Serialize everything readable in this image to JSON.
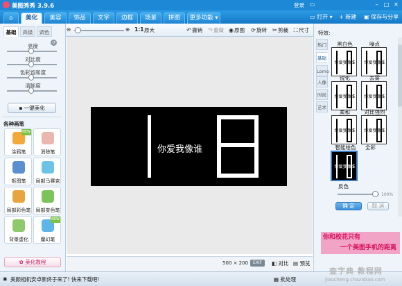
{
  "app": {
    "title": "美图秀秀 3.9.6",
    "login": "登录"
  },
  "menu": {
    "home_icon": "home-icon",
    "tabs": [
      "美化",
      "美容",
      "饰品",
      "文字",
      "边框",
      "场景",
      "拼图",
      "更多功能 ▾"
    ],
    "active_tab": "美化",
    "open": "打开 ▾",
    "new": "新建",
    "save": "保存与分享"
  },
  "toolbar": {
    "zoom_ratio": "1:1",
    "original": "原大",
    "undo": "撤销",
    "redo": "重做",
    "original_image": "原图",
    "rotate": "旋转",
    "crop": "剪裁",
    "size": "尺寸"
  },
  "left": {
    "tabs": [
      "基础",
      "高级",
      "调色"
    ],
    "active_tab": "基础",
    "sliders": [
      {
        "label": "亮度",
        "level": 0.5
      },
      {
        "label": "对比度",
        "level": 0.5
      },
      {
        "label": "色彩饱和度",
        "level": 0.5
      },
      {
        "label": "清晰度",
        "level": 0.5
      }
    ],
    "auto_button": "一键美化",
    "pen_section": "各种画笔",
    "pens": [
      "涂鸦笔",
      "消除笔",
      "抠图笔",
      "局部马赛克",
      "局部彩色笔",
      "局部变色笔",
      "背景虚化",
      "魔幻笔"
    ],
    "new_tag": "NEW",
    "tutorial_button": "美化教程"
  },
  "canvas": {
    "image_text": "你爱我像谁",
    "dimensions": "500 × 200",
    "exif": "EXIF",
    "compare": "对比",
    "preview": "预览"
  },
  "right": {
    "label": "特效:",
    "tabs": [
      "热门",
      "基础",
      "Lomo",
      "人像",
      "时尚",
      "艺术"
    ],
    "active_tab": "基础",
    "effects": [
      "黑白色",
      "噪点",
      "锐化",
      "去雾",
      "柔和",
      "对比强烈",
      "智能绘色",
      "全彩"
    ],
    "selected_effect": "智能绘色",
    "thumb_text": "你爱我像谁",
    "selected_name": "反色",
    "opacity": "100%",
    "opacity_level": 1.0,
    "confirm": "确 定",
    "cancel": "取 消",
    "banner_line1": "你和校花只有",
    "banner_line2": "一个美图手机的距离"
  },
  "bottom": {
    "notice": "美颜相机安卓新终于来了! 快来下载吧!",
    "batch": "批处理"
  },
  "watermark": {
    "line1": "查字典 教程网",
    "line2": "jiaocheng.chazidian.com"
  }
}
